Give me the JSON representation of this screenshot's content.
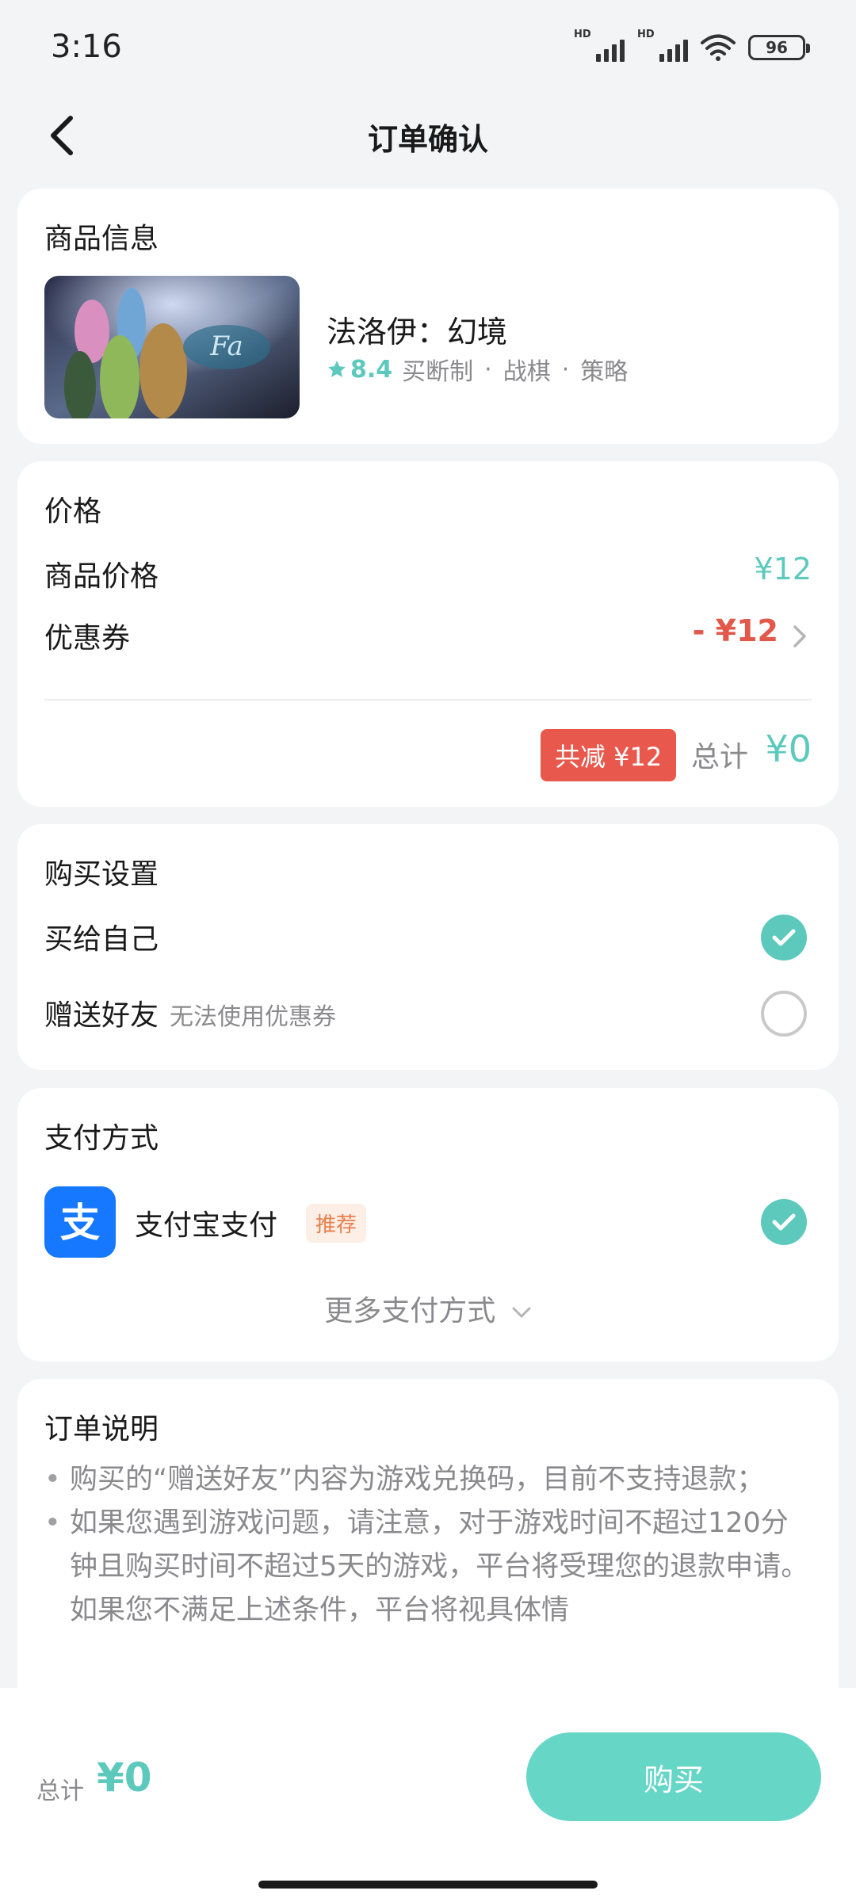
{
  "status": {
    "time": "3:16",
    "battery": "96",
    "hd1": "HD",
    "hd2": "HD"
  },
  "nav": {
    "title": "订单确认"
  },
  "product": {
    "section_title": "商品信息",
    "name": "法洛伊：幻境",
    "rating": "8.4",
    "tags": [
      "买断制",
      "战棋",
      "策略"
    ]
  },
  "price": {
    "section_title": "价格",
    "item_label": "商品价格",
    "item_value": "¥12",
    "coupon_label": "优惠券",
    "coupon_value": "- ¥12",
    "discount_badge": "共减 ¥12",
    "total_label": "总计",
    "total_value": "¥0"
  },
  "purchase_settings": {
    "section_title": "购买设置",
    "option_self": "买给自己",
    "option_gift": "赠送好友",
    "gift_hint": "无法使用优惠券",
    "selected": "self"
  },
  "payment": {
    "section_title": "支付方式",
    "method_name": "支付宝支付",
    "recommend_badge": "推荐",
    "more_label": "更多支付方式"
  },
  "order_notes": {
    "section_title": "订单说明",
    "items": [
      "购买的“赠送好友”内容为游戏兑换码，目前不支持退款；",
      "如果您遇到游戏问题，请注意，对于游戏时间不超过120分钟且购买时间不超过5天的游戏，平台将受理您的退款申请。如果您不满足上述条件，平台将视具体情"
    ]
  },
  "bottom": {
    "total_label": "总计",
    "total_value": "¥0",
    "buy_label": "购买"
  },
  "colors": {
    "accent": "#5cc9bc",
    "discount_red": "#e2584b",
    "alipay_blue": "#1677ff"
  }
}
